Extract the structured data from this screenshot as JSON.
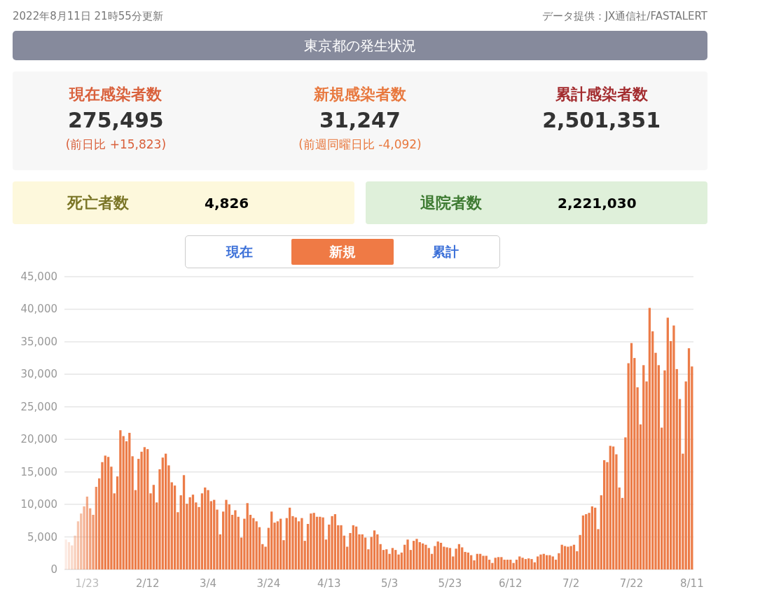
{
  "header": {
    "updated": "2022年8月11日 21時55分更新",
    "source": "データ提供：JX通信社/FASTALERT"
  },
  "title": "東京都の発生状況",
  "stats": [
    {
      "label": "現在感染者数",
      "value": "275,495",
      "change": "(前日比 +15,823)",
      "color": "#d9603b"
    },
    {
      "label": "新規感染者数",
      "value": "31,247",
      "change": "(前週同曜日比 -4,092)",
      "color": "#e8783e"
    },
    {
      "label": "累計感染者数",
      "value": "2,501,351",
      "color": "#a32c2f"
    }
  ],
  "totals": [
    {
      "label": "死亡者数",
      "value": "4,826",
      "kind": "deaths"
    },
    {
      "label": "退院者数",
      "value": "2,221,030",
      "kind": "discharged"
    }
  ],
  "tabs": [
    {
      "label": "現在",
      "selected": false
    },
    {
      "label": "新規",
      "selected": true
    },
    {
      "label": "累計",
      "selected": false
    }
  ],
  "chart": {
    "chart_data": {
      "type": "bar",
      "grid": true,
      "ylim": [
        0,
        45000
      ],
      "categories": [
        null,
        null,
        null,
        null,
        null,
        null,
        null,
        "1/23",
        null,
        null,
        null,
        null,
        null,
        null,
        null,
        null,
        null,
        null,
        null,
        null,
        null,
        null,
        null,
        null,
        null,
        null,
        null,
        "2/12",
        null,
        null,
        null,
        null,
        null,
        null,
        null,
        null,
        null,
        null,
        null,
        null,
        null,
        null,
        null,
        null,
        null,
        null,
        null,
        "3/4",
        null,
        null,
        null,
        null,
        null,
        null,
        null,
        null,
        null,
        null,
        null,
        null,
        null,
        null,
        null,
        null,
        null,
        null,
        null,
        "3/24",
        null,
        null,
        null,
        null,
        null,
        null,
        null,
        null,
        null,
        null,
        null,
        null,
        null,
        null,
        null,
        null,
        null,
        null,
        null,
        "4/13",
        null,
        null,
        null,
        null,
        null,
        null,
        null,
        null,
        null,
        null,
        null,
        null,
        null,
        null,
        null,
        null,
        null,
        null,
        null,
        "5/3",
        null,
        null,
        null,
        null,
        null,
        null,
        null,
        null,
        null,
        null,
        null,
        null,
        null,
        null,
        null,
        null,
        null,
        null,
        null,
        "5/23",
        null,
        null,
        null,
        null,
        null,
        null,
        null,
        null,
        null,
        null,
        null,
        null,
        null,
        null,
        null,
        null,
        null,
        null,
        null,
        "6/12",
        null,
        null,
        null,
        null,
        null,
        null,
        null,
        null,
        null,
        null,
        null,
        null,
        null,
        null,
        null,
        null,
        null,
        null,
        null,
        "7/2",
        null,
        null,
        null,
        null,
        null,
        null,
        null,
        null,
        null,
        null,
        null,
        null,
        null,
        null,
        null,
        null,
        null,
        null,
        null,
        "7/22",
        null,
        null,
        null,
        null,
        null,
        null,
        null,
        null,
        null,
        null,
        null,
        null,
        null,
        null,
        null,
        null,
        null,
        null,
        null,
        "8/11"
      ],
      "yticks": [
        {
          "value": 0,
          "label": "0"
        },
        {
          "value": 5000,
          "label": "5,000"
        },
        {
          "value": 10000,
          "label": "10,000"
        },
        {
          "value": 15000,
          "label": "15,000"
        },
        {
          "value": 20000,
          "label": "20,000"
        },
        {
          "value": 25000,
          "label": "25,000"
        },
        {
          "value": 30000,
          "label": "30,000"
        },
        {
          "value": 35000,
          "label": "35,000"
        },
        {
          "value": 40000,
          "label": "40,000"
        },
        {
          "value": 45000,
          "label": "45,000"
        }
      ],
      "values": [
        4600,
        4200,
        3700,
        5200,
        7400,
        8600,
        9700,
        11200,
        9400,
        8400,
        12700,
        14000,
        16500,
        17500,
        17300,
        15800,
        11700,
        14300,
        21400,
        20500,
        19700,
        21000,
        17400,
        12200,
        17000,
        18100,
        18800,
        18500,
        11700,
        13000,
        10300,
        15400,
        17200,
        17800,
        16000,
        13400,
        12900,
        8800,
        11400,
        14500,
        10100,
        11100,
        11500,
        10300,
        9600,
        11700,
        12600,
        12200,
        10500,
        10700,
        9200,
        5400,
        8900,
        10700,
        10000,
        8400,
        9100,
        8100,
        4900,
        7800,
        10200,
        8400,
        7900,
        7400,
        6500,
        3900,
        3500,
        6400,
        8900,
        7200,
        7400,
        7800,
        4500,
        7900,
        9500,
        8200,
        8000,
        7400,
        7900,
        4400,
        7000,
        8600,
        8700,
        8100,
        8100,
        8000,
        4600,
        6900,
        8200,
        8500,
        6800,
        6800,
        5200,
        3500,
        5600,
        6800,
        6600,
        5400,
        5400,
        4900,
        3100,
        5000,
        6000,
        5400,
        3900,
        3000,
        3100,
        2400,
        3300,
        3000,
        2300,
        2600,
        3800,
        4600,
        3000,
        4400,
        4700,
        4200,
        4000,
        3800,
        3300,
        2400,
        3600,
        4300,
        4100,
        3500,
        3400,
        3300,
        2000,
        3200,
        3900,
        3400,
        2700,
        2600,
        2200,
        1400,
        2400,
        2400,
        2100,
        2100,
        1500,
        1000,
        1800,
        1900,
        1900,
        1500,
        1500,
        1500,
        1000,
        1500,
        2000,
        1800,
        1600,
        1700,
        1600,
        1100,
        2000,
        2300,
        2400,
        2200,
        2200,
        2000,
        1500,
        2500,
        3800,
        3600,
        3500,
        3600,
        3800,
        2800,
        5300,
        8300,
        8500,
        8700,
        9700,
        9500,
        6200,
        11400,
        16800,
        16500,
        19000,
        18900,
        17700,
        12600,
        11000,
        20300,
        31700,
        34800,
        32500,
        28000,
        22300,
        31400,
        28900,
        40200,
        36600,
        33300,
        31400,
        21800,
        30600,
        38700,
        35100,
        37500,
        30800,
        26200,
        17800,
        28900,
        34000,
        31200
      ]
    }
  }
}
